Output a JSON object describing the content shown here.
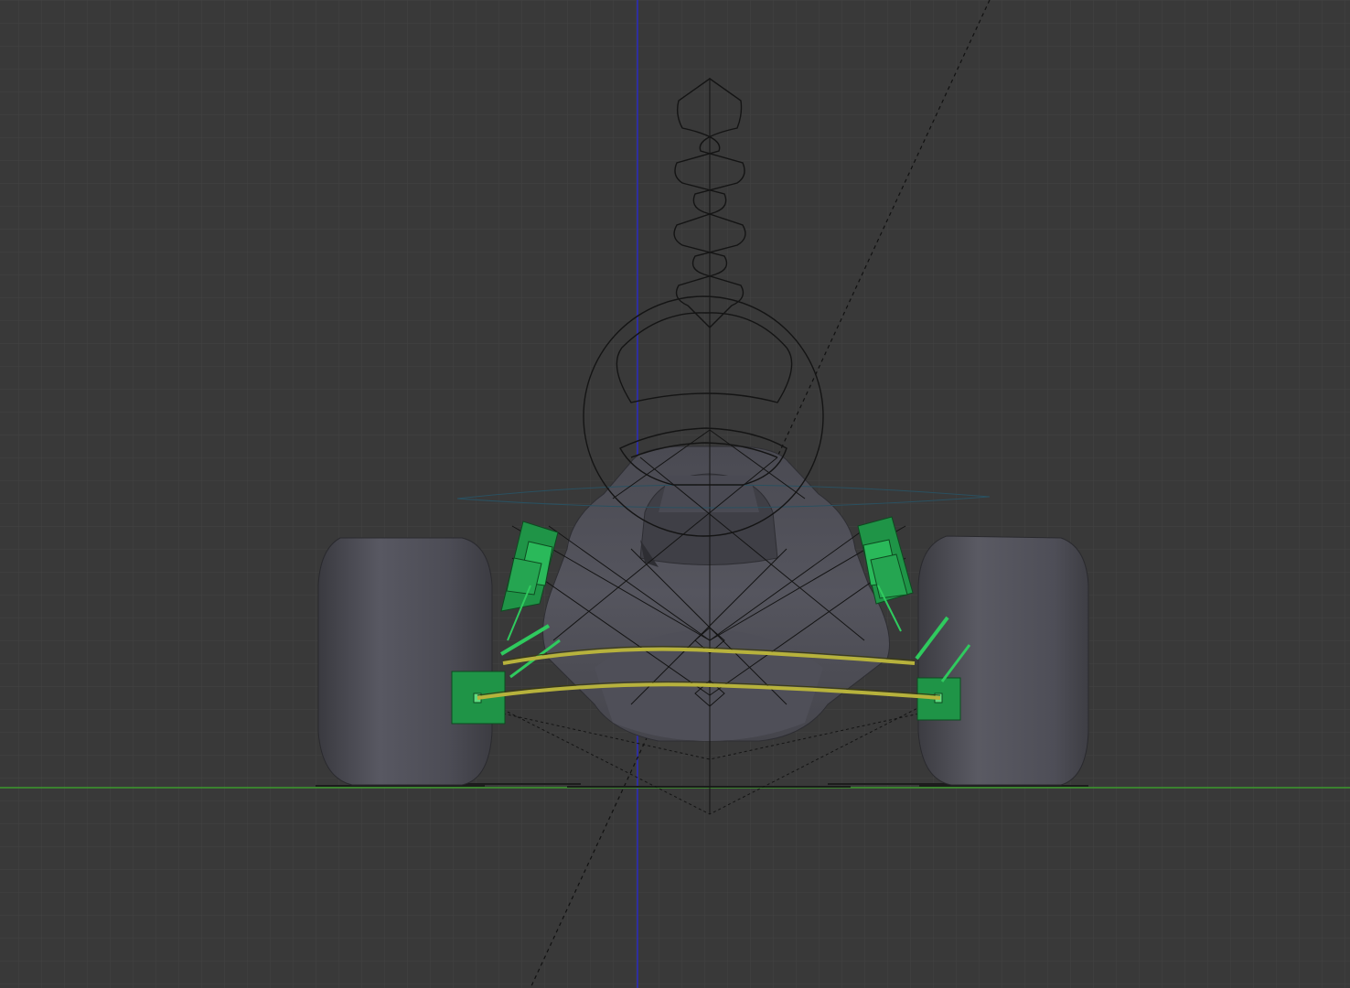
{
  "viewport": {
    "view": "front-orthographic",
    "background_color": "#393939",
    "grid_color": "#444444",
    "z_axis_color": "#2b2bc0",
    "y_axis_color": "#3c9a2c",
    "shaded_body_color": "#505058",
    "selection_color": "#22a048",
    "constraint_color": "#b7b23c"
  },
  "objects": [
    {
      "kind": "rig-controller",
      "shape": "wavy-arrow",
      "selected": false
    },
    {
      "kind": "rig-controller",
      "shape": "steering-circle",
      "selected": false
    },
    {
      "kind": "mesh",
      "name": "left-wheel"
    },
    {
      "kind": "mesh",
      "name": "right-wheel"
    },
    {
      "kind": "mesh",
      "name": "chassis"
    },
    {
      "kind": "bone-group",
      "name": "left-suspension",
      "selected": true
    },
    {
      "kind": "bone-group",
      "name": "right-suspension",
      "selected": true
    },
    {
      "kind": "track-line",
      "name": "upper-arm-constraint"
    },
    {
      "kind": "track-line",
      "name": "lower-arm-constraint"
    },
    {
      "kind": "camera-guide",
      "style": "dashed"
    }
  ]
}
